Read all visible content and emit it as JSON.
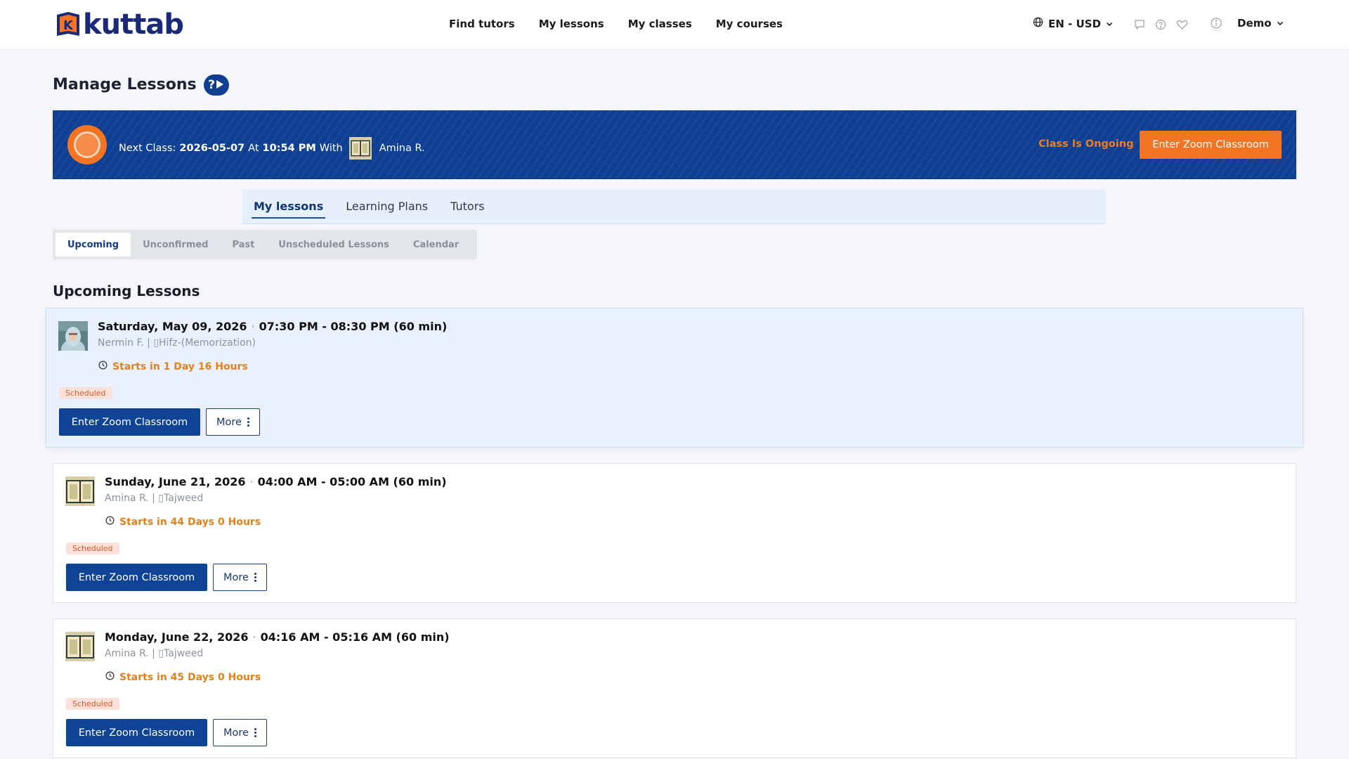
{
  "header": {
    "logo_text": "kuttab",
    "nav": [
      "Find tutors",
      "My lessons",
      "My classes",
      "My courses"
    ],
    "locale": "EN - USD",
    "user": "Demo",
    "icons": [
      "chat-icon",
      "help-icon",
      "heart-icon",
      "info-icon",
      "globe-icon"
    ]
  },
  "page": {
    "title": "Manage Lessons",
    "help_icon": "?"
  },
  "banner": {
    "prefix": "Next Class:",
    "date": "2026-05-07",
    "at": "At",
    "time": "10:54 PM",
    "with": "With",
    "tutor": "Amina R.",
    "status": "Class Is Ongoing",
    "button": "Enter Zoom Classroom",
    "colors": {
      "background": "#0e3f93",
      "accent": "#f37524"
    }
  },
  "tabs": [
    "My lessons",
    "Learning Plans",
    "Tutors"
  ],
  "subtabs": [
    "Upcoming",
    "Unconfirmed",
    "Past",
    "Unscheduled Lessons",
    "Calendar"
  ],
  "section_title": "Upcoming Lessons",
  "lessons": [
    {
      "date": "Saturday, May 09, 2026",
      "time": "07:30 PM - 08:30 PM (60 min)",
      "tutor_course": "Nermin F. | ▯Hifz-(Memorization)",
      "starts": "Starts in 1 Day 16 Hours",
      "status": "Scheduled",
      "zoom": "Enter Zoom Classroom",
      "more": "More"
    },
    {
      "date": "Sunday, June 21, 2026",
      "time": "04:00 AM - 05:00 AM (60 min)",
      "tutor_course": "Amina R. | ▯Tajweed",
      "starts": "Starts in 44 Days 0 Hours",
      "status": "Scheduled",
      "zoom": "Enter Zoom Classroom",
      "more": "More"
    },
    {
      "date": "Monday, June 22, 2026",
      "time": "04:16 AM - 05:16 AM (60 min)",
      "tutor_course": "Amina R. | ▯Tajweed",
      "starts": "Starts in 45 Days 0 Hours",
      "status": "Scheduled",
      "zoom": "Enter Zoom Classroom",
      "more": "More"
    }
  ]
}
